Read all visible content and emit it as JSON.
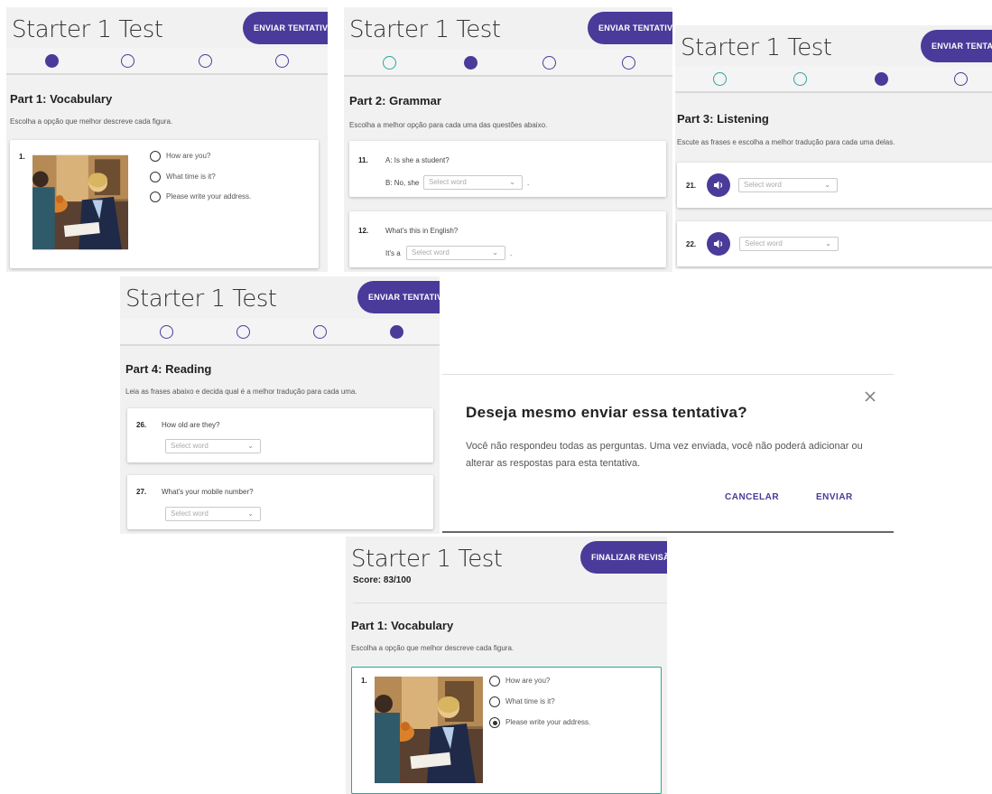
{
  "app": {
    "title": "Starter 1 Test",
    "submit_label": "ENVIAR TENTATIVA",
    "finish_review_label": "FINALIZAR REVISÃO"
  },
  "colors": {
    "accent": "#4a3b9a",
    "done": "#2aa79b",
    "panel_bg": "#f1f1f1"
  },
  "select_placeholder": "Select word",
  "part1": {
    "title": "Part 1: Vocabulary",
    "instruction": "Escolha a opção que melhor descreve cada figura.",
    "question_number": "1.",
    "options": [
      "How are you?",
      "What time is it?",
      "Please write your address."
    ]
  },
  "part2": {
    "title": "Part 2: Grammar",
    "instruction": "Escolha a melhor opção para cada uma das questões abaixo.",
    "questions": [
      {
        "number": "11.",
        "prompt": "A: Is she a student?",
        "lead": "B: No, she",
        "tail": "."
      },
      {
        "number": "12.",
        "prompt": "What's this in English?",
        "lead": "It's a",
        "tail": "."
      }
    ]
  },
  "part3": {
    "title": "Part 3: Listening",
    "instruction": "Escute as frases e escolha a melhor tradução para cada uma delas.",
    "questions": [
      {
        "number": "21."
      },
      {
        "number": "22."
      }
    ]
  },
  "part4": {
    "title": "Part 4: Reading",
    "instruction": "Leia as frases abaixo e decida qual é a melhor tradução para cada uma.",
    "questions": [
      {
        "number": "26.",
        "prompt": "How old are they?"
      },
      {
        "number": "27.",
        "prompt": "What's your mobile number?"
      }
    ]
  },
  "dialog": {
    "title": "Deseja mesmo enviar essa tentativa?",
    "body": "Você não respondeu todas as perguntas. Uma vez enviada, você não poderá adicionar ou alterar as respostas para esta tentativa.",
    "cancel_label": "CANCELAR",
    "confirm_label": "ENVIAR"
  },
  "review": {
    "score_label": "Score: 83/100",
    "selected_option": "Please write your address."
  }
}
